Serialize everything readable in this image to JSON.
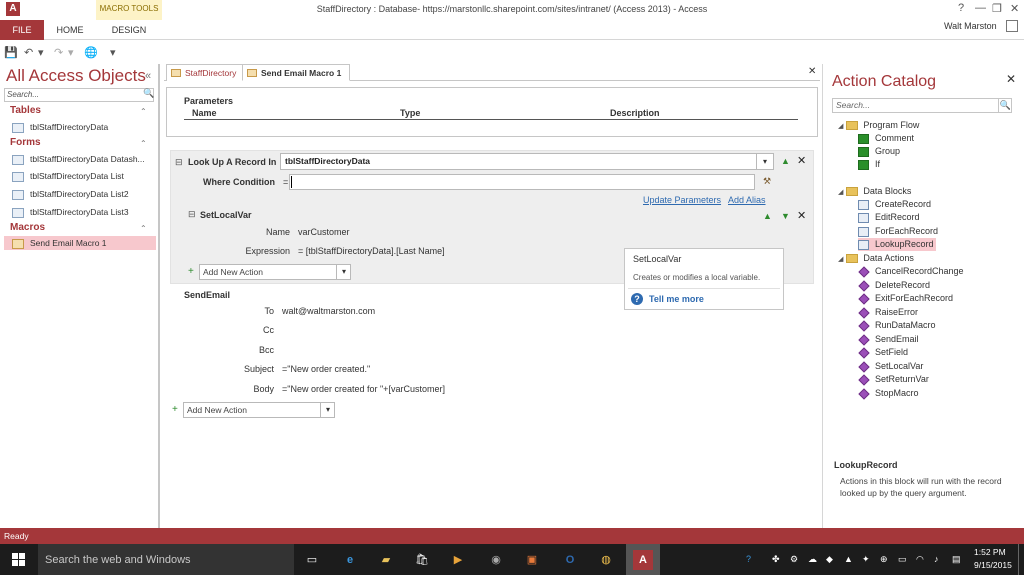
{
  "window": {
    "title": "StaffDirectory : Database- https://marstonllc.sharepoint.com/sites/intranet/ (Access 2013) - Access",
    "help_glyph": "?",
    "minimize_glyph": "—",
    "restore_glyph": "❐",
    "close_glyph": "✕",
    "app_icon_letter": "A"
  },
  "ribbon": {
    "tabs": [
      "FILE",
      "HOME",
      "DESIGN"
    ],
    "contextual_group": "MACRO TOOLS",
    "user": "Walt Marston"
  },
  "nav": {
    "title": "All Access Objects",
    "collapse_glyph": "«",
    "search_placeholder": "Search...",
    "groups": [
      {
        "label": "Tables",
        "items": [
          "tblStaffDirectoryData"
        ]
      },
      {
        "label": "Forms",
        "items": [
          "tblStaffDirectoryData Datash...",
          "tblStaffDirectoryData List",
          "tblStaffDirectoryData List2",
          "tblStaffDirectoryData List3"
        ]
      },
      {
        "label": "Macros",
        "items": [
          "Send Email Macro 1"
        ]
      }
    ],
    "group_chevron": "⌃"
  },
  "doc_tabs": {
    "tabs": [
      "StaffDirectory",
      "Send Email Macro 1"
    ],
    "active": "Send Email Macro 1",
    "close_glyph": "✕"
  },
  "parameters": {
    "title": "Parameters",
    "columns": [
      "Name",
      "Type",
      "Description"
    ]
  },
  "lookup": {
    "label": "Look Up A Record In",
    "value": "tblStaffDirectoryData",
    "where_label": "Where Condition",
    "where_eq": "=",
    "where_value": "",
    "links": [
      "Update Parameters",
      "Add Alias"
    ]
  },
  "setlocalvar": {
    "label": "SetLocalVar",
    "name_label": "Name",
    "name_value": "varCustomer",
    "expr_label": "Expression",
    "expr_value": "= [tblStaffDirectoryData].[Last Name]"
  },
  "add_action_placeholder": "Add New Action",
  "sendemail": {
    "label": "SendEmail",
    "fields": [
      {
        "label": "To",
        "value": "walt@waltmarston.com"
      },
      {
        "label": "Cc",
        "value": ""
      },
      {
        "label": "Bcc",
        "value": ""
      },
      {
        "label": "Subject",
        "value": "=\"New order created.\""
      },
      {
        "label": "Body",
        "value": "=\"New order created for \"+[varCustomer]"
      }
    ]
  },
  "tooltip": {
    "title": "SetLocalVar",
    "description": "Creates or modifies a local variable.",
    "link": "Tell me more"
  },
  "catalog": {
    "title": "Action Catalog",
    "close_glyph": "✕",
    "search_placeholder": "Search...",
    "folders": [
      {
        "label": "Program Flow",
        "items": [
          "Comment",
          "Group",
          "If"
        ]
      },
      {
        "label": "Data Blocks",
        "items": [
          "CreateRecord",
          "EditRecord",
          "ForEachRecord",
          "LookupRecord"
        ]
      },
      {
        "label": "Data Actions",
        "items": [
          "CancelRecordChange",
          "DeleteRecord",
          "ExitForEachRecord",
          "RaiseError",
          "RunDataMacro",
          "SendEmail",
          "SetField",
          "SetLocalVar",
          "SetReturnVar",
          "StopMacro"
        ]
      }
    ],
    "selected": "LookupRecord",
    "desc_title": "LookupRecord",
    "desc_text": "Actions in this block will run with the record looked up by the query argument."
  },
  "status": {
    "text": "Ready"
  },
  "taskbar": {
    "search_placeholder": "Search the web and Windows",
    "time": "1:52 PM",
    "date": "9/15/2015"
  },
  "colors": {
    "access_red": "#a4373a",
    "selection_pink": "#f7c8cd",
    "link_blue": "#2e6ab0",
    "taskbar": "#1c1c1c"
  }
}
